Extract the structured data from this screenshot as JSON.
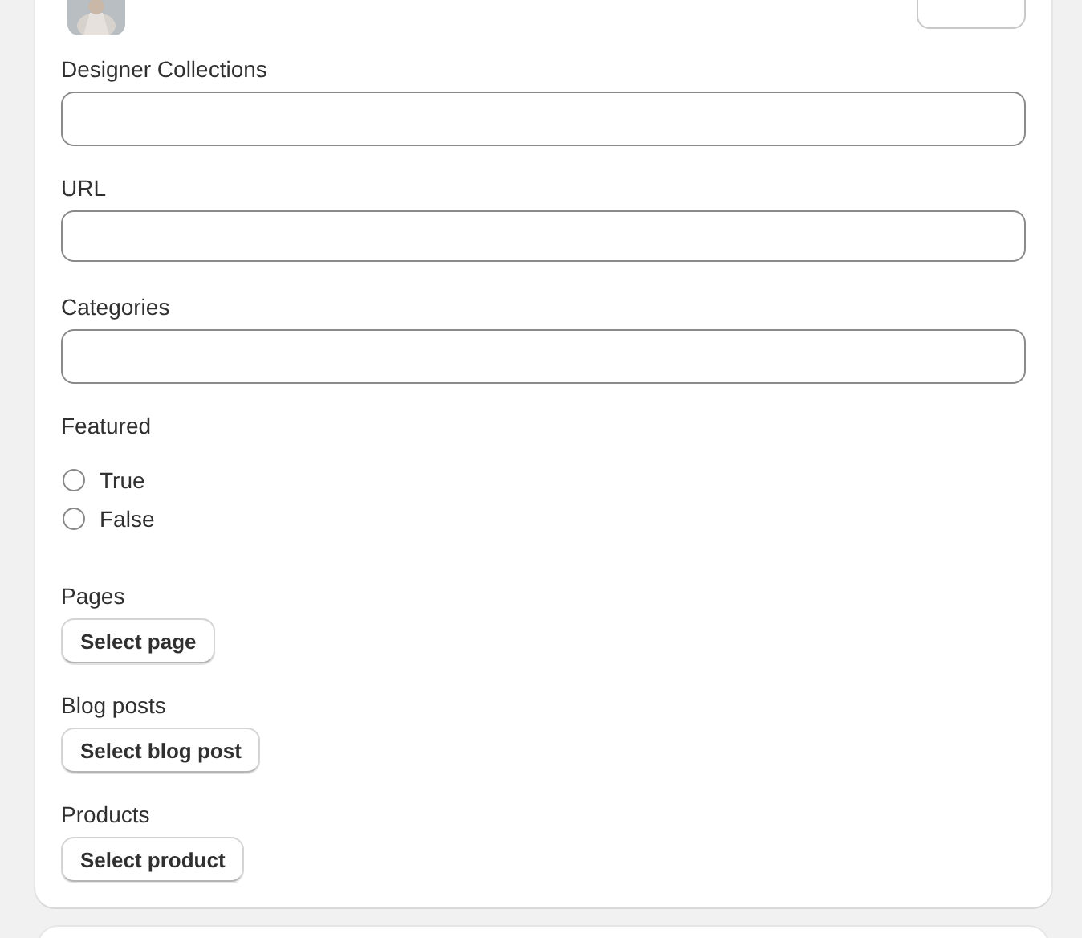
{
  "text_fields": [
    {
      "label": "Designer Collections"
    },
    {
      "label": "URL"
    },
    {
      "label": "Categories"
    }
  ],
  "featured": {
    "label": "Featured",
    "options": [
      {
        "label": "True",
        "selected": false
      },
      {
        "label": "False",
        "selected": false
      }
    ]
  },
  "pickers": [
    {
      "label": "Pages",
      "button": "Select page"
    },
    {
      "label": "Blog posts",
      "button": "Select blog post"
    },
    {
      "label": "Products",
      "button": "Select product"
    }
  ]
}
